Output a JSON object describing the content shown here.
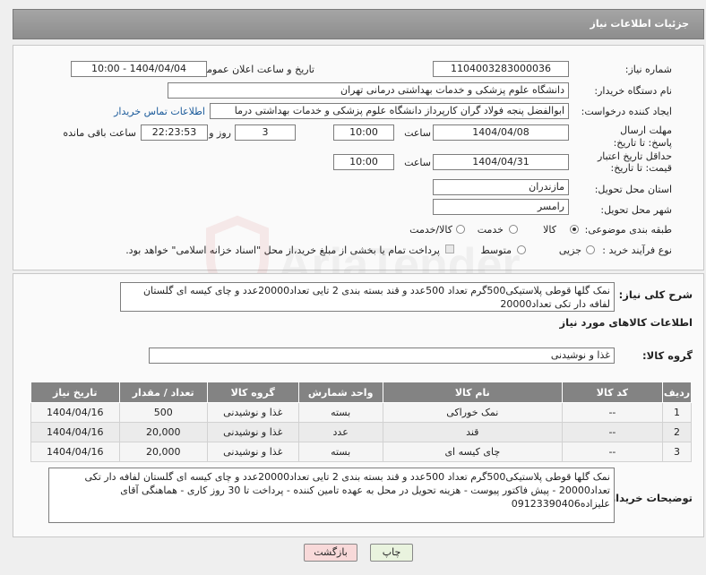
{
  "header": {
    "title": "جزئیات اطلاعات نیاز"
  },
  "form": {
    "need_number_label": "شماره نیاز:",
    "need_number": "1104003283000036",
    "announce_label": "تاریخ و ساعت اعلان عمومی:",
    "announce_value": "1404/04/04 - 10:00",
    "buyer_org_label": "نام دستگاه خریدار:",
    "buyer_org": "دانشگاه علوم پزشکی و خدمات بهداشتی درمانی تهران",
    "creator_label": "ایجاد کننده درخواست:",
    "creator": "ابوالفضل  پنجه فولاد گران  کارپرداز دانشگاه علوم پزشکی و خدمات بهداشتی درما",
    "contact_link": "اطلاعات تماس خریدار",
    "reply_deadline_label": "مهلت ارسال پاسخ: تا تاریخ:",
    "reply_date": "1404/04/08",
    "time_label": "ساعت",
    "reply_time": "10:00",
    "days": "3",
    "days_label": "روز و",
    "remaining_time": "22:23:53",
    "remaining_label": "ساعت باقی مانده",
    "price_validity_label": "حداقل تاریخ اعتبار قیمت: تا تاریخ:",
    "price_date": "1404/04/31",
    "price_time": "10:00",
    "province_label": "استان محل تحویل:",
    "province": "مازندران",
    "city_label": "شهر محل تحویل:",
    "city": "رامسر",
    "category_label": "طبقه بندی موضوعی:",
    "category_options": [
      "کالا",
      "خدمت",
      "کالا/خدمت"
    ],
    "process_label": "نوع فرآیند خرید :",
    "process_options": [
      "جزیی",
      "متوسط"
    ],
    "payment_note": "پرداخت تمام یا بخشی از مبلغ خرید،از محل \"اسناد خزانه اسلامی\" خواهد بود."
  },
  "description": {
    "label": "شرح کلی نیاز:",
    "text": "نمک گلها قوطی پلاستیکی500گرم تعداد 500عدد و قند بسته بندی 2 تایی تعداد20000عدد و چای کیسه ای گلستان لفافه دار تکی تعداد20000"
  },
  "goods": {
    "section_title": "اطلاعات کالاهای مورد نیاز",
    "group_label": "گروه کالا:",
    "group_value": "غذا و نوشیدنی",
    "columns": [
      "ردیف",
      "کد کالا",
      "نام کالا",
      "واحد شمارش",
      "گروه کالا",
      "تعداد / مقدار",
      "تاریخ نیاز"
    ],
    "rows": [
      {
        "idx": "1",
        "code": "--",
        "name": "نمک خوراکی",
        "unit": "بسته",
        "group": "غذا و نوشیدنی",
        "qty": "500",
        "date": "1404/04/16"
      },
      {
        "idx": "2",
        "code": "--",
        "name": "قند",
        "unit": "عدد",
        "group": "غذا و نوشیدنی",
        "qty": "20,000",
        "date": "1404/04/16"
      },
      {
        "idx": "3",
        "code": "--",
        "name": "چای کیسه ای",
        "unit": "بسته",
        "group": "غذا و نوشیدنی",
        "qty": "20,000",
        "date": "1404/04/16"
      }
    ]
  },
  "buyer_notes": {
    "label": "توضیحات خریدار:",
    "text": "نمک گلها قوطی پلاستیکی500گرم تعداد 500عدد و قند بسته بندی 2 تایی تعداد20000عدد و چای کیسه ای گلستان لفافه دار تکی تعداد20000 - پیش فاکتور پیوست - هزینه تحویل در محل به عهده تامین کننده - پرداخت تا 30 روز کاری - هماهنگی آقای علیزاده09123390406"
  },
  "buttons": {
    "print": "چاپ",
    "back": "بازگشت"
  },
  "watermark": "AriaTender.neT",
  "colors": {
    "header": "#929292",
    "table_header": "#838383",
    "link": "#1a5a9a",
    "back_button": "#f8d9d9",
    "print_button": "#e9f3de"
  }
}
